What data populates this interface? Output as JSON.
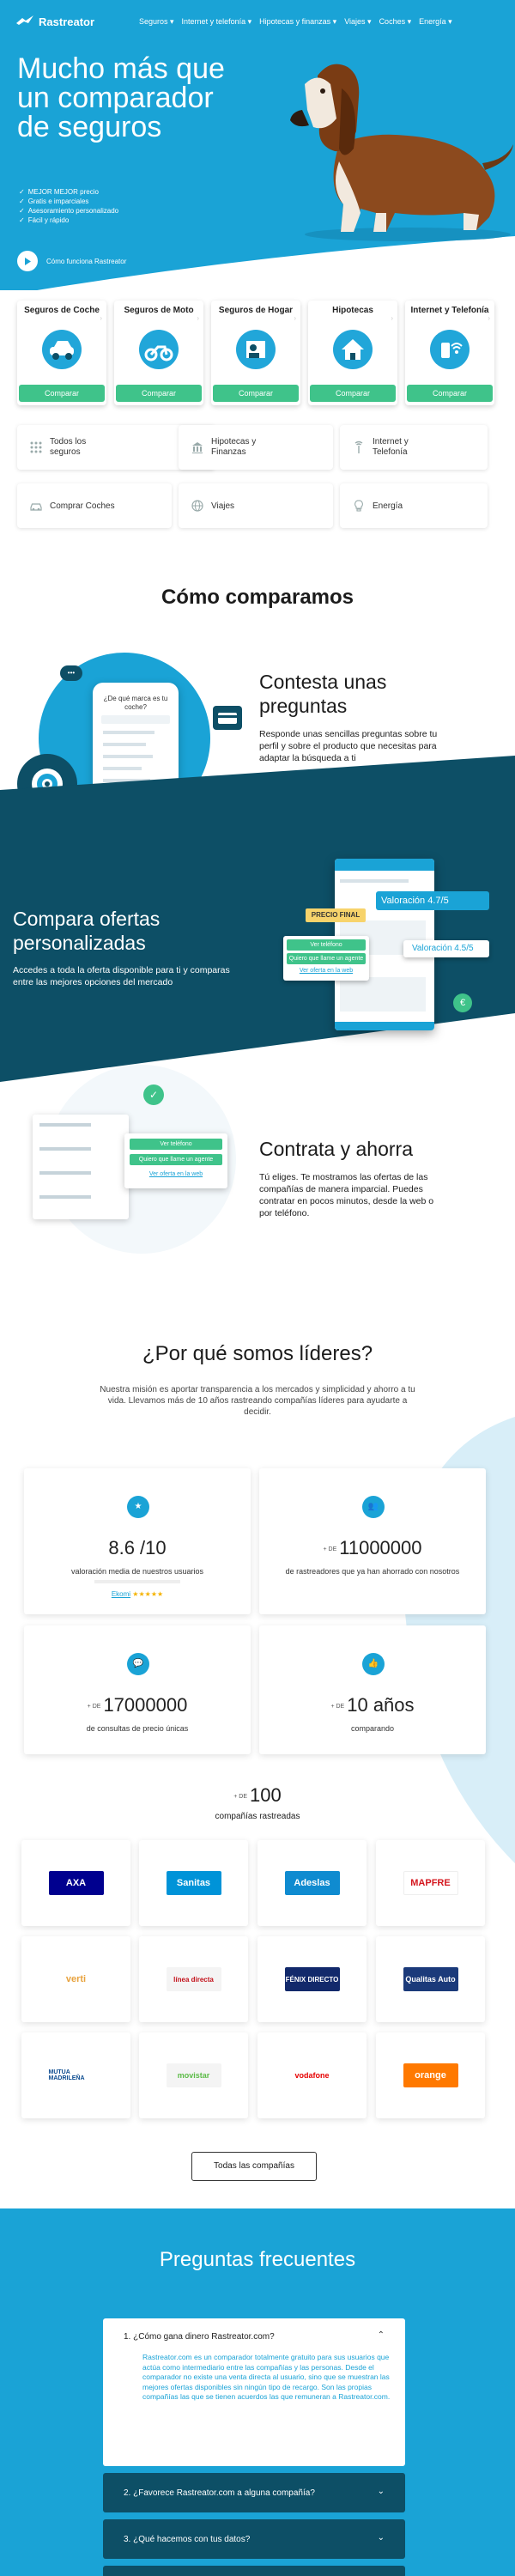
{
  "nav": {
    "brand": "Rastreator",
    "items": [
      "Seguros ▾",
      "Internet y telefonía ▾",
      "Hipotecas y finanzas ▾",
      "Viajes ▾",
      "Coches ▾",
      "Energía ▾"
    ]
  },
  "hero": {
    "title": "Mucho más que un comparador de seguros",
    "bullets": [
      "MEJOR MEJOR precio",
      "Gratis e imparciales",
      "Asesoramiento personalizado",
      "Fácil y rápido"
    ],
    "video_label": "Cómo funciona Rastreator"
  },
  "products": [
    {
      "title": "Seguros de Coche",
      "icon": "car-icon",
      "button": "Comparar"
    },
    {
      "title": "Seguros de Moto",
      "icon": "motorbike-icon",
      "button": "Comparar"
    },
    {
      "title": "Seguros de Hogar",
      "icon": "home-insurance-icon",
      "button": "Comparar"
    },
    {
      "title": "Hipotecas",
      "icon": "house-icon",
      "button": "Comparar"
    },
    {
      "title": "Internet y Telefonía",
      "icon": "wifi-phone-icon",
      "button": "Comparar"
    }
  ],
  "secondary": [
    {
      "label": "Todos los seguros",
      "icon": "grid-icon"
    },
    {
      "label": "Hipotecas y Finanzas",
      "icon": "bank-icon"
    },
    {
      "label": "Internet y Telefonía",
      "icon": "antenna-icon"
    },
    {
      "label": "Comprar Coches",
      "icon": "car-outline-icon"
    },
    {
      "label": "Viajes",
      "icon": "globe-icon"
    },
    {
      "label": "Energía",
      "icon": "bulb-icon"
    }
  ],
  "how": {
    "title": "Cómo comparamos",
    "step1_title": "Contesta unas preguntas",
    "step1_text": "Responde unas sencillas preguntas sobre tu perfil y sobre el producto que necesitas para adaptar la búsqueda a ti",
    "phone_question": "¿De qué marca es tu coche?",
    "step2_title": "Compara ofertas personalizadas",
    "step2_text": "Accedes a toda la oferta disponible para ti y comparas entre las mejores opciones del mercado",
    "precio_final": "PRECIO FINAL",
    "valoracion1": "Valoración 4.7/5",
    "valoracion2": "Valoración 4.5/5",
    "ver_telefono": "Ver teléfono",
    "quiero_gestor": "Quiero que llame un agente",
    "ver_ofertas": "Ver oferta en la web",
    "step3_title": "Contrata y ahorra",
    "step3_text": "Tú eliges. Te mostramos las ofertas de las compañías de manera imparcial. Puedes contratar en pocos minutos, desde la web o por teléfono."
  },
  "leaders": {
    "title": "¿Por qué somos líderes?",
    "text": "Nuestra misión es aportar transparencia a los mercados y simplicidad y ahorro a tu vida. Llevamos más de 10 años rastreando compañías líderes para ayudarte a decidir.",
    "mas": "+ DE",
    "stats": [
      {
        "value": "8.6 /10",
        "label": "valoración media de nuestros usuarios",
        "icon": "star-icon",
        "source": "Ekomi",
        "stars": "★★★★★"
      },
      {
        "value": "11000000",
        "label": "de rastreadores que ya han ahorrado con nosotros",
        "icon": "users-icon"
      },
      {
        "value": "17000000",
        "label": "de consultas de precio únicas",
        "icon": "chat-icon"
      },
      {
        "value": "10 años",
        "label": "comparando",
        "icon": "thumbs-up-icon"
      }
    ],
    "companies_value": "100",
    "companies_label": "compañías rastreadas",
    "logos": [
      {
        "name": "AXA",
        "color": "#00008f"
      },
      {
        "name": "Sanitas",
        "color": "#0093d8"
      },
      {
        "name": "Adeslas",
        "color": "#0f8bd0"
      },
      {
        "name": "MAPFRE",
        "color": "#d4161e"
      },
      {
        "name": "verti",
        "color": "#e8a23d"
      },
      {
        "name": "línea directa",
        "color": "#c3111a"
      },
      {
        "name": "FÉNIX DIRECTO",
        "color": "#12296b"
      },
      {
        "name": "Qualitas Auto",
        "color": "#1b3a7a"
      },
      {
        "name": "MUTUA MADRILEÑA",
        "color": "#0a4a8f"
      },
      {
        "name": "movistar",
        "color": "#5bbb46"
      },
      {
        "name": "vodafone",
        "color": "#e60000"
      },
      {
        "name": "orange",
        "color": "#ff7900"
      }
    ],
    "all_button": "Todas las compañías"
  },
  "faq": {
    "title": "Preguntas frecuentes",
    "items": [
      {
        "q": "1.  ¿Cómo gana dinero Rastreator.com?",
        "a": "Rastreator.com es un comparador totalmente gratuito para sus usuarios que actúa como intermediario entre las compañías y las personas. Desde el comparador no existe una venta directa al usuario, sino que se muestran las mejores ofertas disponibles sin ningún tipo de recargo. Son las propias compañías las que se tienen acuerdos las que remuneran a Rastreator.com."
      },
      {
        "q": "2.  ¿Favorece Rastreator.com a alguna compañía?"
      },
      {
        "q": "3.  ¿Qué hacemos con tus datos?"
      }
    ]
  }
}
